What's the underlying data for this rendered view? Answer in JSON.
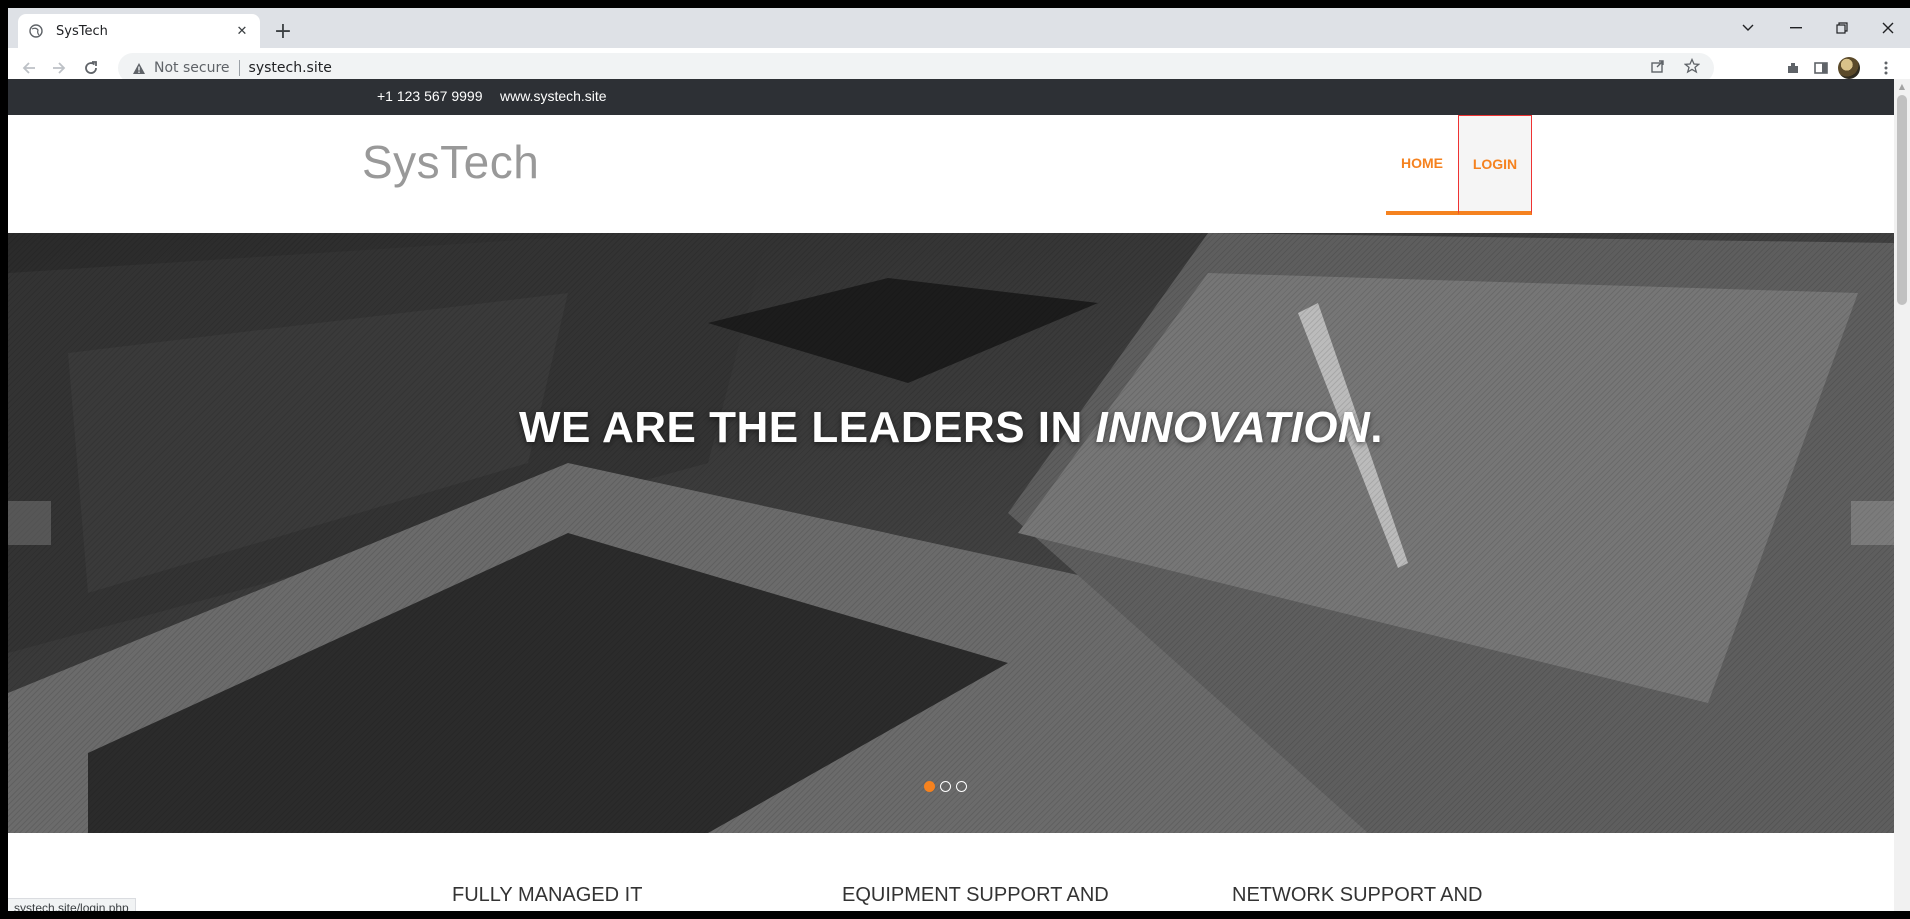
{
  "browser": {
    "tab_title": "SysTech",
    "new_tab": "+",
    "close_tab": "✕",
    "address": {
      "security_label": "Not secure",
      "url": "systech.site"
    },
    "status_url": "systech.site/login.php"
  },
  "topbar": {
    "phone": "+1 123 567 9999",
    "website": "www.systech.site"
  },
  "header": {
    "logo": "SysTech",
    "nav": [
      {
        "label": "HOME"
      },
      {
        "label": "LOGIN"
      }
    ]
  },
  "hero": {
    "title_main": "WE ARE THE LEADERS IN ",
    "title_emph": "INNOVATION",
    "title_end": ".",
    "slides": 3,
    "active_slide": 1
  },
  "services": [
    {
      "title": "FULLY MANAGED IT"
    },
    {
      "title": "EQUIPMENT SUPPORT AND"
    },
    {
      "title": "NETWORK SUPPORT AND"
    }
  ],
  "colors": {
    "accent": "#f5821f",
    "topbar": "#2d3035",
    "logo": "#999999"
  }
}
